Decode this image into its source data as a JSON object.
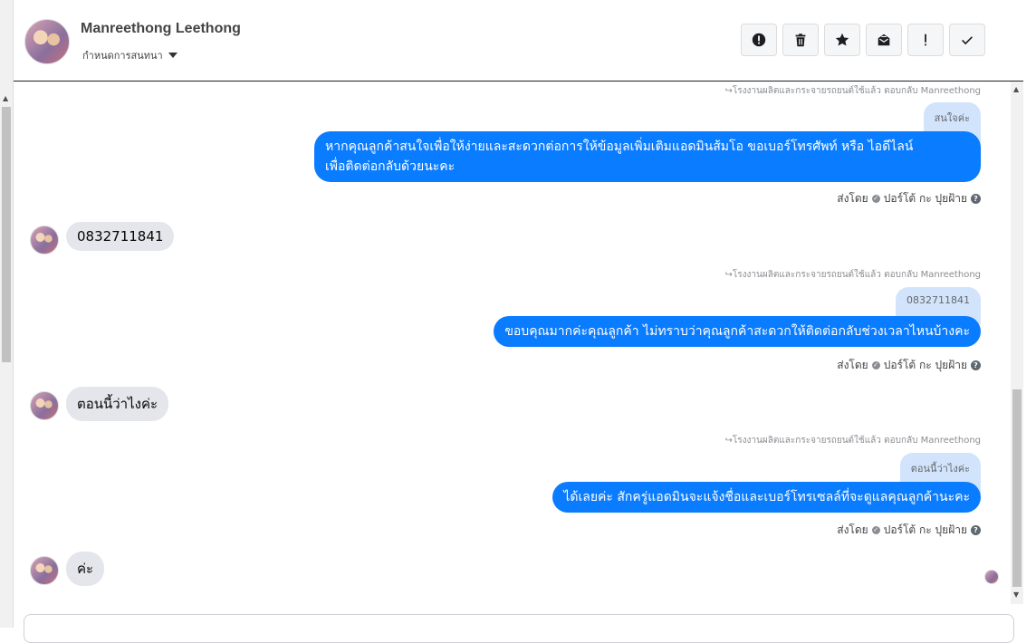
{
  "header": {
    "contact_name": "Manreethong Leethong",
    "assign_label": "กำหนดการสนทนา",
    "toolbar": [
      {
        "icon": "alert-circle-icon",
        "label": "spam"
      },
      {
        "icon": "trash-icon",
        "label": "delete"
      },
      {
        "icon": "star-icon",
        "label": "star"
      },
      {
        "icon": "mark-unread-icon",
        "label": "mark unread"
      },
      {
        "icon": "exclamation-icon",
        "label": "follow up"
      },
      {
        "icon": "check-icon",
        "label": "done"
      }
    ]
  },
  "messages": [
    {
      "type": "outgoing",
      "reply_note": "โรงงานผลิตและกระจายรถยนต์ใช้แล้ว ตอบกลับ Manreethong",
      "quoted": "สนใจค่ะ",
      "text_line1": "หากคุณลูกค้าสนใจเพื่อให้ง่ายและสะดวกต่อการให้ข้อมูลเพิ่มเติมแอดมินส้มโอ ขอเบอร์โทรศัพท์ หรือ ไอดีไลน์",
      "text_line2": "เพื่อติดต่อกลับด้วยนะคะ",
      "sent_by_label": "ส่งโดย",
      "sender": "ปอร์โต้ กะ ปุยฝ้าย"
    },
    {
      "type": "incoming",
      "text": "0832711841"
    },
    {
      "type": "outgoing",
      "reply_note": "โรงงานผลิตและกระจายรถยนต์ใช้แล้ว ตอบกลับ Manreethong",
      "quoted": "0832711841",
      "text": "ขอบคุณมากค่ะคุณลูกค้า ไม่ทราบว่าคุณลูกค้าสะดวกให้ติดต่อกลับช่วงเวลาไหนบ้างคะ",
      "sent_by_label": "ส่งโดย",
      "sender": "ปอร์โต้ กะ ปุยฝ้าย"
    },
    {
      "type": "incoming",
      "text": "ตอนนี้ว่าไงค่ะ"
    },
    {
      "type": "outgoing",
      "reply_note": "โรงงานผลิตและกระจายรถยนต์ใช้แล้ว ตอบกลับ Manreethong",
      "quoted": "ตอนนี้ว่าไงค่ะ",
      "text": "ได้เลยค่ะ สักครู่แอดมินจะแจ้งชื่อและเบอร์โทรเซลล์ที่จะดูแลคุณลูกค้านะคะ",
      "sent_by_label": "ส่งโดย",
      "sender": "ปอร์โต้ กะ ปุยฝ้าย"
    },
    {
      "type": "incoming",
      "text": "ค่ะ"
    }
  ],
  "colors": {
    "outgoing_bubble": "#0a7cff",
    "quoted_bubble": "#d2e4fc",
    "incoming_bubble": "#e4e6eb"
  }
}
